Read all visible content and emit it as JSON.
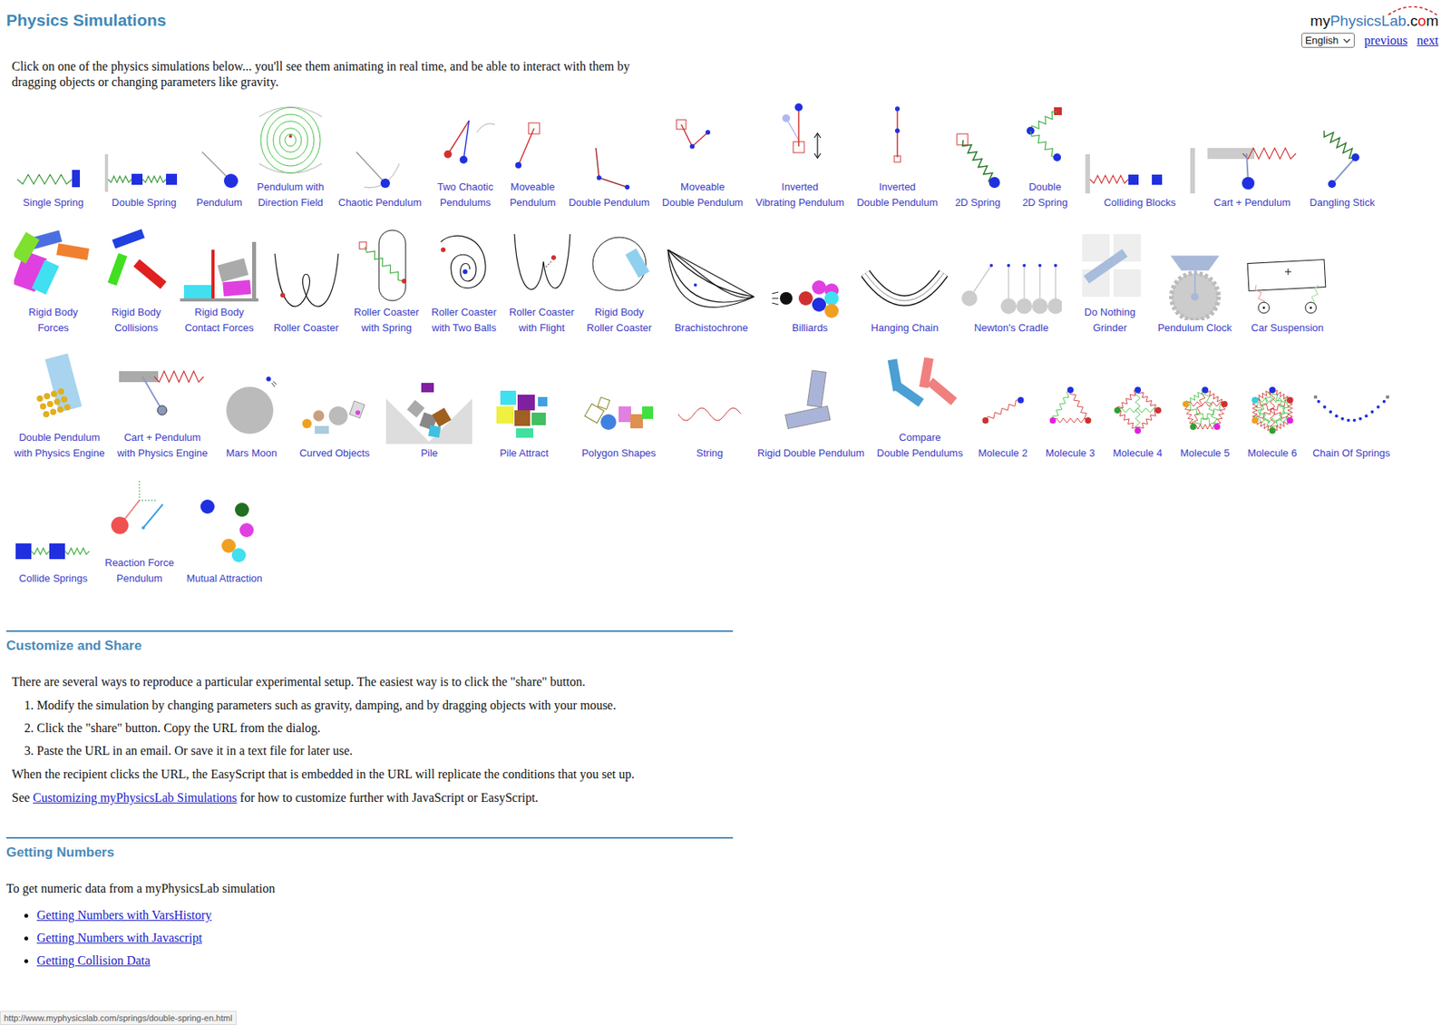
{
  "header": {
    "title": "Physics Simulations",
    "logo": [
      {
        "text": "my",
        "color": "#111111"
      },
      {
        "text": "Physics",
        "color": "#3a78b8"
      },
      {
        "text": "Lab",
        "color": "#3a78b8"
      },
      {
        "text": ".c",
        "color": "#111111"
      },
      {
        "text": "o",
        "color": "#d62020"
      },
      {
        "text": "m",
        "color": "#111111"
      }
    ],
    "language": "English",
    "links": [
      "previous",
      "next"
    ]
  },
  "intro": "Click on one of the physics simulations below... you'll see them animating in real time, and be able to interact with them by dragging objects or changing parameters like gravity.",
  "simulations": {
    "rows": [
      [
        {
          "label": [
            "Single Spring"
          ],
          "kind": "spring"
        },
        {
          "label": [
            "Double Spring"
          ],
          "kind": "double-spring"
        },
        {
          "label": [
            "Pendulum"
          ],
          "kind": "pendulum"
        },
        {
          "label": [
            "Pendulum with",
            "Direction Field"
          ],
          "kind": "direction-field"
        },
        {
          "label": [
            "Chaotic Pendulum"
          ],
          "kind": "chaotic"
        },
        {
          "label": [
            "Two Chaotic",
            "Pendulums"
          ],
          "kind": "two-chaotic"
        },
        {
          "label": [
            "Moveable",
            "Pendulum"
          ],
          "kind": "moveable"
        },
        {
          "label": [
            "Double Pendulum"
          ],
          "kind": "double-pendulum"
        },
        {
          "label": [
            "Moveable",
            "Double Pendulum"
          ],
          "kind": "moveable-double"
        },
        {
          "label": [
            "Inverted",
            "Vibrating Pendulum"
          ],
          "kind": "inverted-vibrating"
        },
        {
          "label": [
            "Inverted",
            "Double Pendulum"
          ],
          "kind": "inverted-double"
        },
        {
          "label": [
            "2D Spring"
          ],
          "kind": "spring-2d"
        },
        {
          "label": [
            "Double",
            "2D Spring"
          ],
          "kind": "double-spring-2d"
        },
        {
          "label": [
            "Colliding Blocks"
          ],
          "kind": "colliding-blocks"
        },
        {
          "label": [
            "Cart + Pendulum"
          ],
          "kind": "cart-pendulum"
        },
        {
          "label": [
            "Dangling Stick"
          ],
          "kind": "dangling-stick"
        }
      ],
      [
        {
          "label": [
            "Rigid Body",
            "Forces"
          ],
          "kind": "rigid-forces"
        },
        {
          "label": [
            "Rigid Body",
            "Collisions"
          ],
          "kind": "rigid-collisions"
        },
        {
          "label": [
            "Rigid Body",
            "Contact Forces"
          ],
          "kind": "contact-forces"
        },
        {
          "label": [
            "Roller Coaster"
          ],
          "kind": "roller"
        },
        {
          "label": [
            "Roller Coaster",
            "with Spring"
          ],
          "kind": "roller-spring"
        },
        {
          "label": [
            "Roller Coaster",
            "with Two Balls"
          ],
          "kind": "roller-two-balls"
        },
        {
          "label": [
            "Roller Coaster",
            "with Flight"
          ],
          "kind": "roller-flight"
        },
        {
          "label": [
            "Rigid Body",
            "Roller Coaster"
          ],
          "kind": "rigid-roller"
        },
        {
          "label": [
            "Brachistochrone"
          ],
          "kind": "brachistochrone"
        },
        {
          "label": [
            "Billiards"
          ],
          "kind": "billiards"
        },
        {
          "label": [
            "Hanging Chain"
          ],
          "kind": "hanging-chain"
        },
        {
          "label": [
            "Newton's Cradle"
          ],
          "kind": "newtons-cradle"
        },
        {
          "label": [
            "Do Nothing",
            "Grinder"
          ],
          "kind": "grinder"
        },
        {
          "label": [
            "Pendulum Clock"
          ],
          "kind": "clock"
        },
        {
          "label": [
            "Car Suspension"
          ],
          "kind": "car"
        }
      ],
      [
        {
          "label": [
            "Double Pendulum",
            "with Physics Engine"
          ],
          "kind": "engine-double"
        },
        {
          "label": [
            "Cart + Pendulum",
            "with Physics Engine"
          ],
          "kind": "engine-cart"
        },
        {
          "label": [
            "Mars Moon"
          ],
          "kind": "mars-moon"
        },
        {
          "label": [
            "Curved Objects"
          ],
          "kind": "curved"
        },
        {
          "label": [
            "Pile"
          ],
          "kind": "pile"
        },
        {
          "label": [
            "Pile Attract"
          ],
          "kind": "pile-attract"
        },
        {
          "label": [
            "Polygon Shapes"
          ],
          "kind": "polygons"
        },
        {
          "label": [
            "String"
          ],
          "kind": "string"
        },
        {
          "label": [
            "Rigid Double Pendulum"
          ],
          "kind": "rigid-double"
        },
        {
          "label": [
            "Compare",
            "Double Pendulums"
          ],
          "kind": "compare-double"
        },
        {
          "label": [
            "Molecule 2"
          ],
          "kind": "molecule-2"
        },
        {
          "label": [
            "Molecule 3"
          ],
          "kind": "molecule-3"
        },
        {
          "label": [
            "Molecule 4"
          ],
          "kind": "molecule-4"
        },
        {
          "label": [
            "Molecule 5"
          ],
          "kind": "molecule-5"
        },
        {
          "label": [
            "Molecule 6"
          ],
          "kind": "molecule-6"
        },
        {
          "label": [
            "Chain Of Springs"
          ],
          "kind": "chain-springs"
        }
      ],
      [
        {
          "label": [
            "Collide Springs"
          ],
          "kind": "collide-springs"
        },
        {
          "label": [
            "Reaction Force",
            "Pendulum"
          ],
          "kind": "reaction"
        },
        {
          "label": [
            "Mutual Attraction"
          ],
          "kind": "mutual"
        }
      ]
    ]
  },
  "customize": {
    "heading": "Customize and Share",
    "paragraph": "There are several ways to reproduce a particular experimental setup. The easiest way is to click the \"share\" button.",
    "steps": [
      "Modify the simulation by changing parameters such as gravity, damping, and by dragging objects with your mouse.",
      "Click the \"share\" button. Copy the URL from the dialog.",
      "Paste the URL in an email. Or save it in a text file for later use."
    ],
    "after": "When the recipient clicks the URL, the EasyScript that is embedded in the URL will replicate the conditions that you set up.",
    "see": {
      "before": "See ",
      "link": "Customizing myPhysicsLab Simulations",
      "after": " for how to customize further with JavaScript or EasyScript."
    }
  },
  "numbers": {
    "heading": "Getting Numbers",
    "text": "To get numeric data from a myPhysicsLab simulation",
    "links": [
      "Getting Numbers with VarsHistory",
      "Getting Numbers with Javascript",
      "Getting Collision Data"
    ]
  },
  "status_bar": {
    "text": "http://www.myphysicslab.com/springs/double-spring-en.html"
  }
}
